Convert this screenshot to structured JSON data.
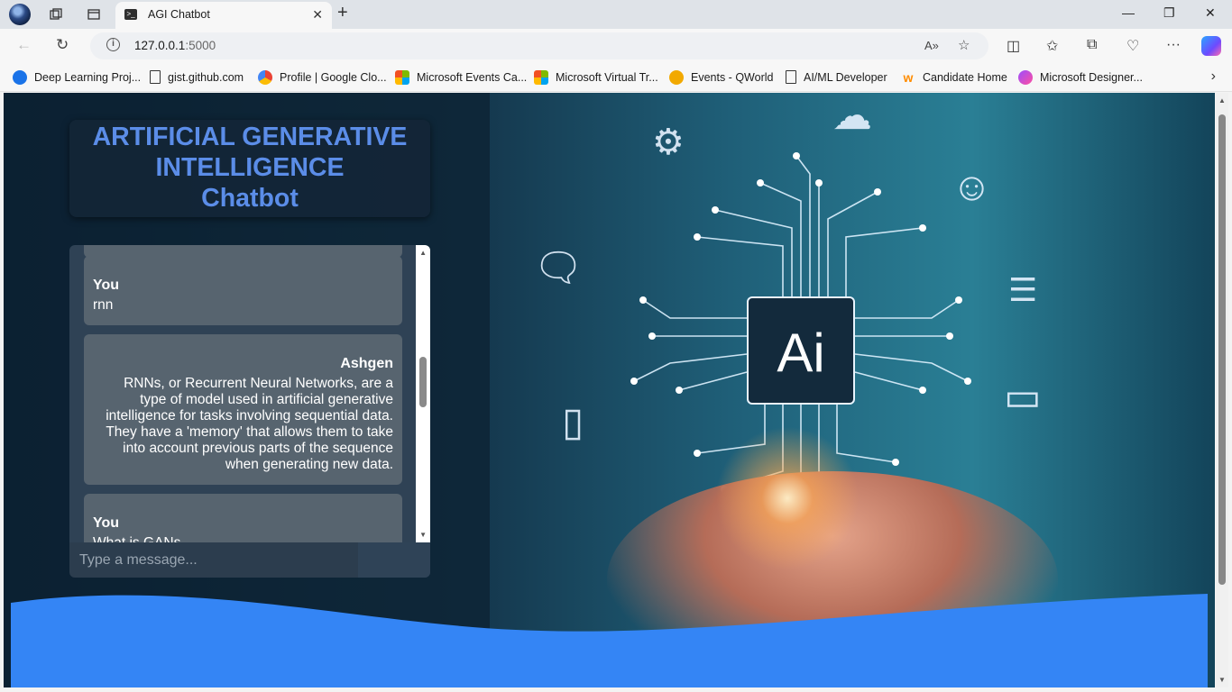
{
  "browser": {
    "tab_title": "AGI Chatbot",
    "url_host": "127.0.0.1",
    "url_port": ":5000",
    "bookmarks": [
      {
        "label": "Deep Learning Proj...",
        "color": "#1a73e8"
      },
      {
        "label": "gist.github.com",
        "color": "#ffffff"
      },
      {
        "label": "Profile | Google Clo...",
        "color": "#ea4335"
      },
      {
        "label": "Microsoft Events Ca...",
        "color": "#f25022"
      },
      {
        "label": "Microsoft Virtual Tr...",
        "color": "#f25022"
      },
      {
        "label": "Events - QWorld",
        "color": "#f2a900"
      },
      {
        "label": "AI/ML Developer",
        "color": "#ffffff"
      },
      {
        "label": "Candidate Home",
        "color": "#ff8c00"
      },
      {
        "label": "Microsoft Designer...",
        "color": "#9b4dff"
      }
    ]
  },
  "app": {
    "title_lines": [
      "ARTIFICIAL GENERATIVE",
      "INTELLIGENCE",
      "Chatbot"
    ],
    "accent_color": "#5b8de8",
    "chip_label": "Ai",
    "messages": [
      {
        "sender": "You",
        "text": "rnn",
        "role": "user"
      },
      {
        "sender": "Ashgen",
        "text": "RNNs, or Recurrent Neural Networks, are a type of model used in artificial generative intelligence for tasks involving sequential data. They have a 'memory' that allows them to take into account previous parts of the sequence when generating new data.",
        "role": "bot"
      },
      {
        "sender": "You",
        "text": "What is GANs",
        "role": "user"
      }
    ],
    "input_placeholder": "Type a message..."
  }
}
